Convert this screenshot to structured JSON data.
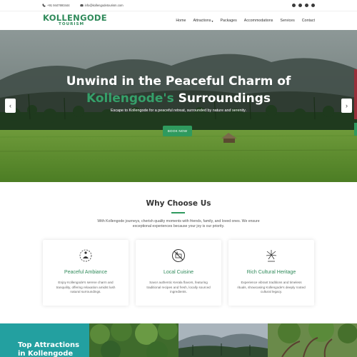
{
  "topbar": {
    "phone": "+91 9447693444",
    "email": "info@kollengodetourism.com",
    "socials": [
      "facebook-icon",
      "twitter-icon",
      "instagram-icon",
      "linkedin-icon"
    ]
  },
  "header": {
    "logo_main": "KOLLENGODE",
    "logo_sub": "TOURISM",
    "nav": [
      {
        "label": "Home"
      },
      {
        "label": "Attractions"
      },
      {
        "label": "Packages"
      },
      {
        "label": "Accommodations"
      },
      {
        "label": "Services"
      },
      {
        "label": "Contact"
      }
    ]
  },
  "hero": {
    "title_line1": "Unwind in the Peaceful Charm of",
    "title_accent": "Kollengode's",
    "title_rest": " Surroundings",
    "subtitle": "Escape to Kollengode for a peaceful retreat, surrounded by nature and serenity.",
    "button": "BOOK NOW",
    "prev": "‹",
    "next": "›"
  },
  "why": {
    "title": "Why Choose Us",
    "description": "With Kollengode journeys, cherish quality moments with friends, family, and loved ones. We ensure exceptional experiences because your joy is our priority.",
    "cards": [
      {
        "icon": "meditation-icon",
        "title": "Peaceful Ambiance",
        "desc": "Enjoy Kollengode's serene charm and tranquility, offering relaxation amidst lush natural surroundings."
      },
      {
        "icon": "no-fast-food-icon",
        "title": "Local Cuisine",
        "desc": "Savor authentic Kerala flavors, featuring traditional recipes and fresh, locally sourced ingredients."
      },
      {
        "icon": "fireworks-icon",
        "title": "Rich Cultural Heritage",
        "desc": "Experience vibrant traditions and timeless rituals, showcasing Kollengode's deeply rooted cultural legacy."
      }
    ]
  },
  "attractions": {
    "title_line1": "Top Attractions",
    "title_line2": "in Kollengode"
  },
  "colors": {
    "brand_green": "#2f8a5a",
    "accent_green": "#35a06a",
    "button_green": "#2f9a5e",
    "teal": "#23a0a0"
  }
}
